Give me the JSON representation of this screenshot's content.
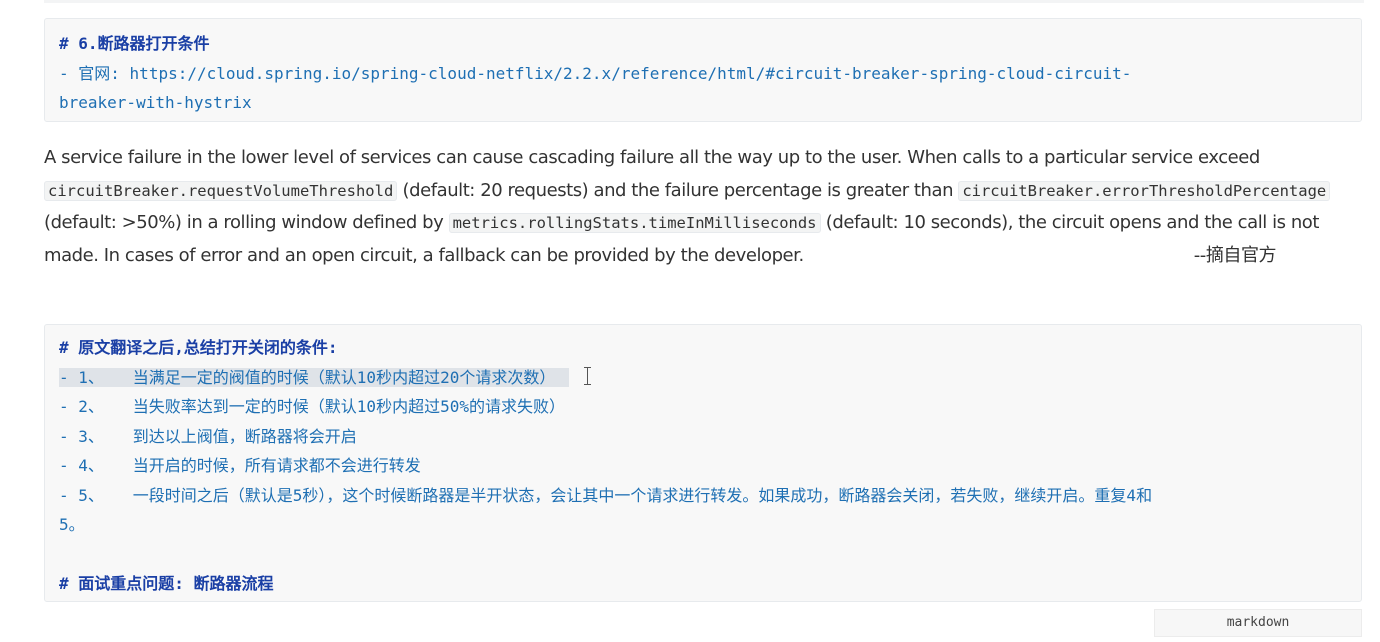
{
  "block1": {
    "heading": "# 6.断路器打开条件",
    "link_prefix": "- 官网: ",
    "link_line1": "https://cloud.spring.io/spring-cloud-netflix/2.2.x/reference/html/#circuit-breaker-spring-cloud-circuit-",
    "link_line2": "breaker-with-hystrix"
  },
  "prose": {
    "t1": "A service failure in the lower level of services can cause cascading failure all the way up to the user. When calls to a particular service exceed ",
    "c1": "circuitBreaker.requestVolumeThreshold",
    "t2": " (default: 20 requests) and the failure percentage is greater than ",
    "c2": "circuitBreaker.errorThresholdPercentage",
    "t3": " (default: >50%) in a rolling window defined by ",
    "c3": "metrics.rollingStats.timeInMilliseconds",
    "t4": " (default: 10 seconds), the circuit opens and the call is not made. In cases of error and an open circuit, a fallback can be provided by the developer.",
    "attribution": "--摘自官方"
  },
  "block2": {
    "heading": "# 原文翻译之后,总结打开关闭的条件:",
    "items": [
      "- 1、   当满足一定的阀值的时候（默认10秒内超过20个请求次数）",
      "- 2、   当失败率达到一定的时候（默认10秒内超过50%的请求失败）",
      "- 3、   到达以上阀值，断路器将会开启",
      "- 4、   当开启的时候，所有请求都不会进行转发",
      "- 5、   一段时间之后（默认是5秒），这个时候断路器是半开状态，会让其中一个请求进行转发。如果成功，断路器会关闭，若失败，继续开启。重复4和",
      "5。"
    ],
    "heading2": "# 面试重点问题: 断路器流程"
  },
  "code_language": "markdown"
}
